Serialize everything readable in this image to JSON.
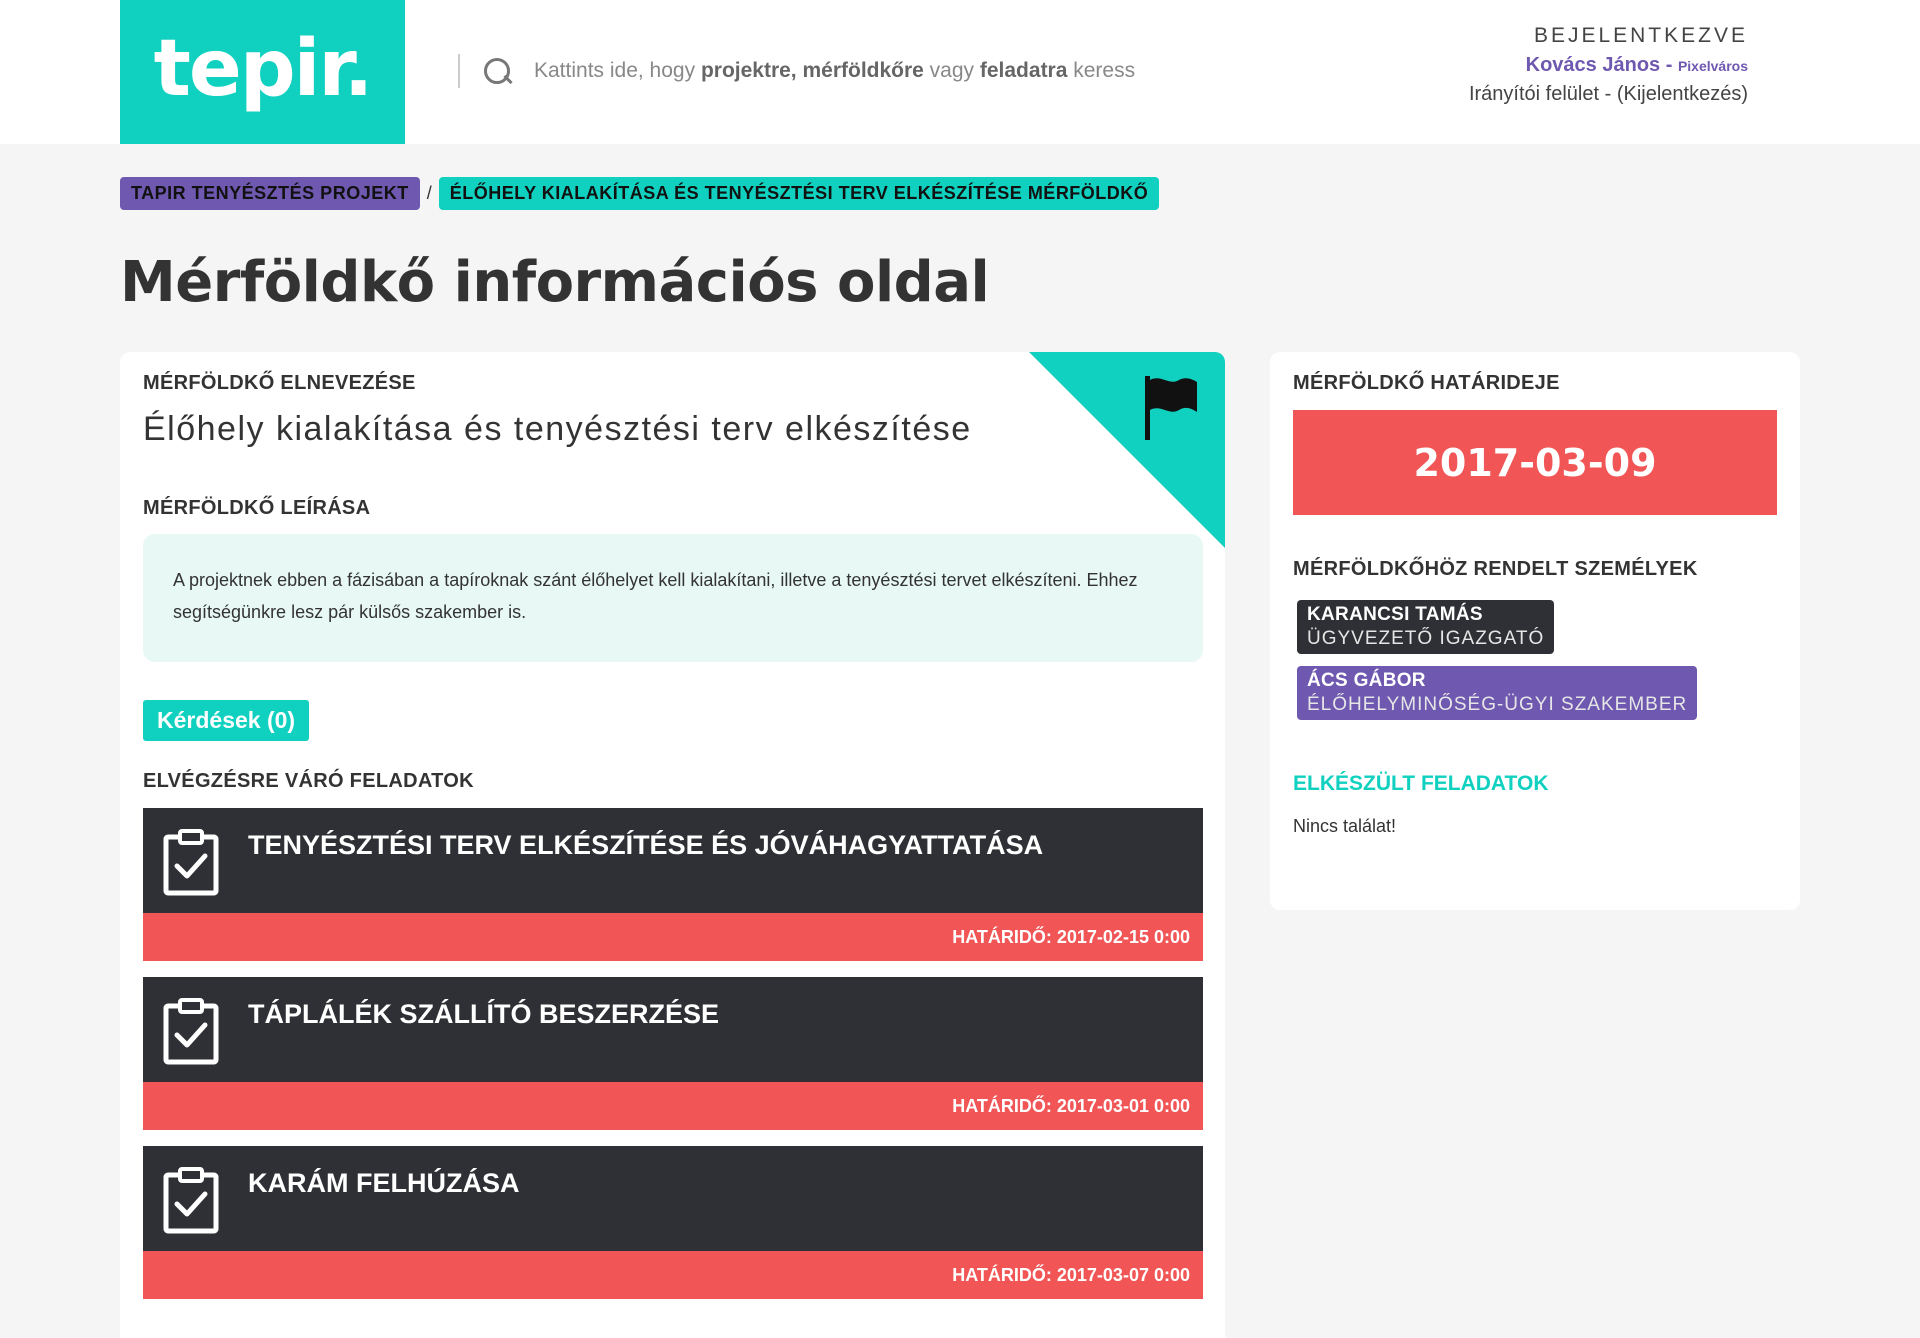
{
  "header": {
    "logo_text": "tepir.",
    "search": {
      "part1": "Kattints ide, hogy ",
      "bold1": "projektre, mérföldkőre",
      "part2": " vagy ",
      "bold2": "feladatra",
      "part3": " keress"
    },
    "user": {
      "status_label": "BEJELENTKEZVE",
      "name": "Kovács János -",
      "city": "Pixelváros",
      "dashboard_link": "Irányítói felület",
      "separator": " - ",
      "logout_link": "(Kijelentkezés)"
    }
  },
  "breadcrumb": {
    "project": "TAPIR TENYÉSZTÉS PROJEKT",
    "separator": "/",
    "milestone": "ÉLŐHELY KIALAKÍTÁSA ÉS TENYÉSZTÉSI TERV ELKÉSZÍTÉSE MÉRFÖLDKŐ"
  },
  "page_title": "Mérföldkő információs oldal",
  "milestone": {
    "name_label": "MÉRFÖLDKŐ ELNEVEZÉSE",
    "name": "Élőhely kialakítása és tenyésztési terv elkészítése",
    "desc_label": "MÉRFÖLDKŐ LEÍRÁSA",
    "description": "A projektnek ebben a fázisában a tapíroknak szánt élőhelyet kell kialakítani, illetve a tenyésztési tervet elkészíteni. Ehhez segítségünkre lesz pár külsős szakember is.",
    "questions_button": "Kérdések (0)",
    "pending_label": "ELVÉGZÉSRE VÁRÓ FELADATOK",
    "tasks": [
      {
        "title": "TENYÉSZTÉSI TERV ELKÉSZÍTÉSE ÉS JÓVÁHAGYATTATÁSA",
        "deadline": "HATÁRIDŐ: 2017-02-15 0:00"
      },
      {
        "title": "TÁPLÁLÉK SZÁLLÍTÓ BESZERZÉSE",
        "deadline": "HATÁRIDŐ: 2017-03-01 0:00"
      },
      {
        "title": "KARÁM FELHÚZÁSA",
        "deadline": "HATÁRIDŐ: 2017-03-07 0:00"
      }
    ]
  },
  "sidebar": {
    "deadline_label": "MÉRFÖLDKŐ HATÁRIDEJE",
    "deadline": "2017-03-09",
    "people_label": "MÉRFÖLDKŐHÖZ RENDELT SZEMÉLYEK",
    "people": [
      {
        "name": "KARANCSI TAMÁS",
        "role": "ÜGYVEZETŐ IGAZGATÓ"
      },
      {
        "name": "ÁCS GÁBOR",
        "role": "ÉLŐHELYMINŐSÉG-ÜGYI SZAKEMBER"
      }
    ],
    "done_label": "ELKÉSZÜLT FELADATOK",
    "no_result": "Nincs találat!"
  },
  "colors": {
    "accent": "#10d0bf",
    "purple": "#6e58b0",
    "danger": "#f25555",
    "dark": "#2e3035"
  },
  "icons": [
    "search-icon",
    "flag-icon",
    "clipboard-check-icon"
  ]
}
